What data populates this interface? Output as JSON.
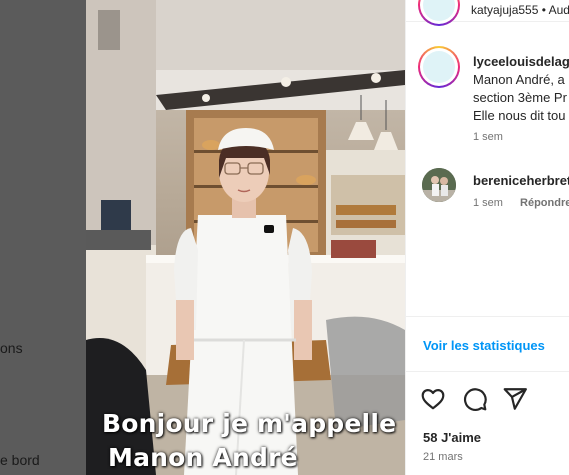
{
  "backdrop": {
    "fragment_1": "ons",
    "fragment_2": "e bord"
  },
  "video": {
    "caption_line_1": "Bonjour je m'appelle",
    "caption_line_2": "Manon André"
  },
  "header": {
    "username": "katyajuja555",
    "separator": "•",
    "trailing": "Aud"
  },
  "comments": [
    {
      "username": "lyceelouisdelag",
      "lines": [
        "Manon André, a",
        "section 3ème Pr",
        "Elle nous dit tou"
      ],
      "time": "1 sem",
      "avatar_icon": "school-logo-icon"
    },
    {
      "username": "bereniceherbret",
      "time": "1 sem",
      "reply_label": "Répondre",
      "avatar_icon": "user-photo-icon"
    }
  ],
  "stats_link": "Voir les statistiques",
  "actions": {
    "like_icon": "heart-icon",
    "comment_icon": "comment-icon",
    "share_icon": "share-icon"
  },
  "likes": "58 J'aime",
  "date": "21 mars",
  "colors": {
    "accent_blue": "#0095f6",
    "text_primary": "#262626",
    "text_secondary": "#737373"
  }
}
